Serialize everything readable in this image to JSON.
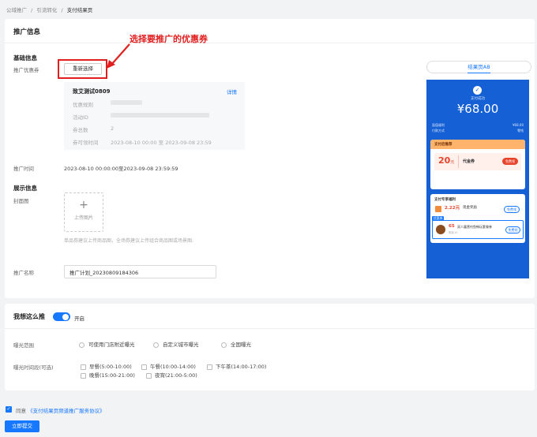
{
  "breadcrumb": [
    "公域推广",
    "引流转化",
    "支付结果页"
  ],
  "breadcrumb_sep": "/",
  "section_title": "推广信息",
  "annotation": "选择要推广的优惠券",
  "basic": {
    "title": "基础信息",
    "coupon_label": "推广优惠券",
    "reselect": "重新选择"
  },
  "coupon": {
    "name": "致艾测试0809",
    "detail": "详情",
    "f1": "优惠规则",
    "f2": "活动ID",
    "f3": "券总数",
    "v3": "2",
    "f4": "券可领时间",
    "v4": "2023-08-10 00:00 至 2023-09-08 23:59"
  },
  "promo_time": {
    "label": "推广时间",
    "value": "2023-08-10 00:00:00至2023-09-08 23:59:59"
  },
  "display": {
    "title": "展示信息",
    "cover_label": "封面图",
    "upload_plus": "+",
    "upload_text": "上传图片",
    "hint": "单品券建议上传商品图，全场券建议上传组合商品图或场景图:"
  },
  "promo_name": {
    "label": "推广名称",
    "value": "推广计划_20230809184306"
  },
  "preview": {
    "tab": "结果页AB",
    "paid_text": "支付成功",
    "amount": "¥68.00",
    "row_left": "面值福利",
    "row_right": "¥68.00",
    "row2_left": "付款方式",
    "row2_right": "零钱",
    "rec_title": "支付后推荐",
    "voucher_amount": "20",
    "voucher_unit": "元",
    "voucher_name": "代金券",
    "voucher_btn": "免费领",
    "welfare_title": "支付专享福利",
    "w1_amount": "2.22元",
    "w1_name": "现金奖励",
    "w1_btn": "免费领",
    "w2_amount": "65",
    "w2_name": "双人露营钓鱼畅玩套餐券",
    "w2_sub": "剩余10",
    "w2_btn": "免费领",
    "w_tag": "优惠券"
  },
  "push": {
    "title": "我想这么推",
    "toggle": "开启"
  },
  "exposure": {
    "label": "曝光范围",
    "opts": [
      "可使用门店附近曝光",
      "自定义城市曝光",
      "全国曝光"
    ]
  },
  "period": {
    "label": "曝光时间段(可选)",
    "opts": [
      "早餐(5:00-10:00)",
      "午餐(10:00-14:00)",
      "下午茶(14:00-17:00)",
      "晚餐(15:00-21:00)",
      "夜宵(21:00-5:00)"
    ]
  },
  "agree": {
    "prefix": "同意",
    "link": "《支付结果页频道推广服务协议》"
  },
  "submit": "立即提交",
  "colors": {
    "primary": "#1677ff",
    "annotation": "#e02020",
    "preview_bg": "#1560d4"
  }
}
